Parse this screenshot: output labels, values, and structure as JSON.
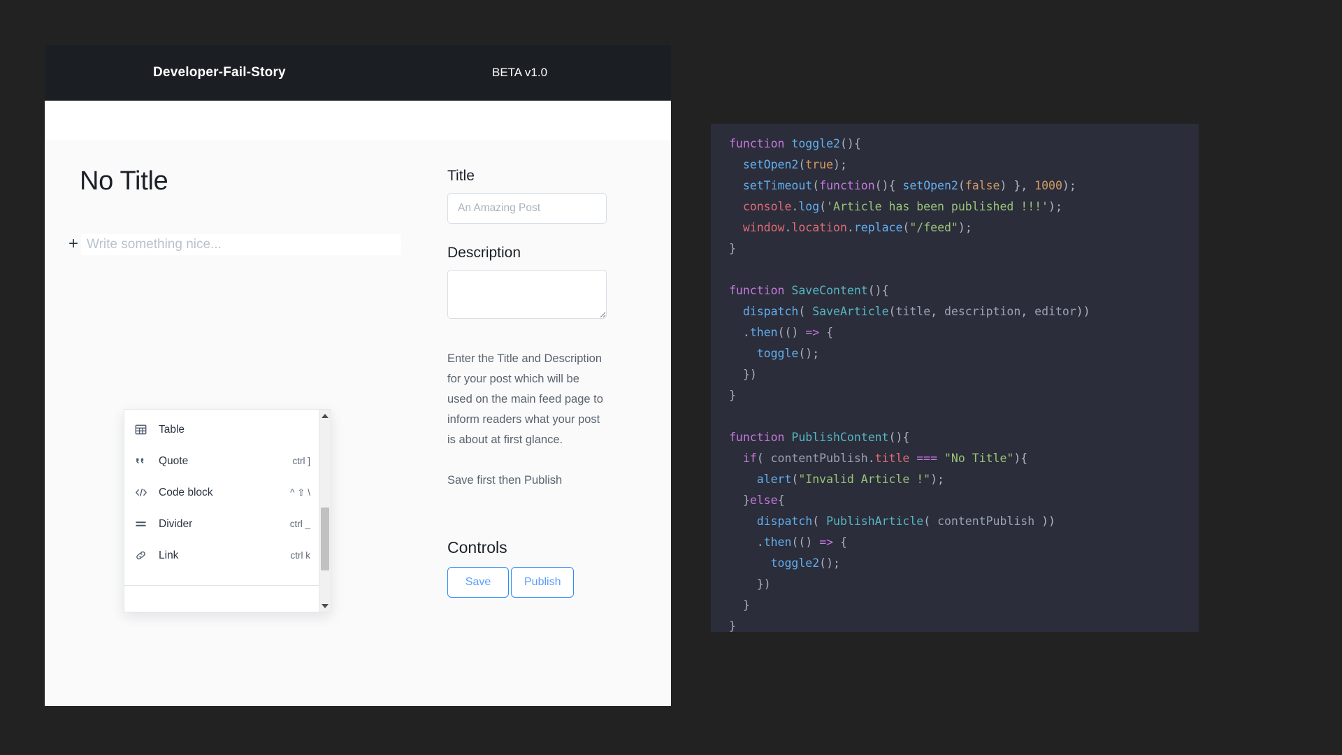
{
  "header": {
    "brand": "Developer-Fail-Story",
    "version_badge": "BETA v1.0"
  },
  "editor": {
    "doc_title": "No Title",
    "add_block_icon": "plus-icon",
    "body_placeholder": "Write something nice..."
  },
  "slash_menu": {
    "items": [
      {
        "icon": "table-icon",
        "label": "Table",
        "shortcut": ""
      },
      {
        "icon": "quote-icon",
        "label": "Quote",
        "shortcut": "ctrl ]"
      },
      {
        "icon": "code-icon",
        "label": "Code block",
        "shortcut": "^ ⇧ \\"
      },
      {
        "icon": "divider-icon",
        "label": "Divider",
        "shortcut": "ctrl _"
      },
      {
        "icon": "link-icon",
        "label": "Link",
        "shortcut": "ctrl k"
      }
    ],
    "scrollbar": {
      "up_arrow": "triangle-up-icon",
      "down_arrow": "triangle-down-icon"
    }
  },
  "meta_panel": {
    "title_label": "Title",
    "title_value": "",
    "title_placeholder": "An Amazing Post",
    "description_label": "Description",
    "description_value": "",
    "description_placeholder": "",
    "help_text": "Enter the Title and Description for your post which will be used on the main feed page to inform readers what your post is about at first glance.",
    "save_hint": "Save first then Publish",
    "controls_heading": "Controls",
    "save_label": "Save",
    "publish_label": "Publish"
  },
  "code_panel": {
    "language": "javascript",
    "background": "#2b2d3a",
    "lines": [
      "function toggle2(){",
      "  setOpen2(true);",
      "  setTimeout(function(){ setOpen2(false) }, 1000);",
      "  console.log('Article has been published !!!');",
      "  window.location.replace(\"/feed\");",
      "}",
      "",
      "function SaveContent(){",
      "  dispatch( SaveArticle(title, description, editor))",
      "  .then(() => {",
      "    toggle();",
      "  })",
      "}",
      "",
      "function PublishContent(){",
      "  if( contentPublish.title === \"No Title\"){",
      "    alert(\"Invalid Article !\");",
      "  }else{",
      "    dispatch( PublishArticle( contentPublish ))",
      "    .then(() => {",
      "      toggle2();",
      "    })",
      "  }",
      "}"
    ]
  },
  "colors": {
    "page_background": "#222222",
    "header_background": "#1b1f24",
    "card_background": "#ffffff",
    "body_background": "#fafafa",
    "accent_blue": "#2f8bfd",
    "code_background": "#2b2d3a"
  }
}
